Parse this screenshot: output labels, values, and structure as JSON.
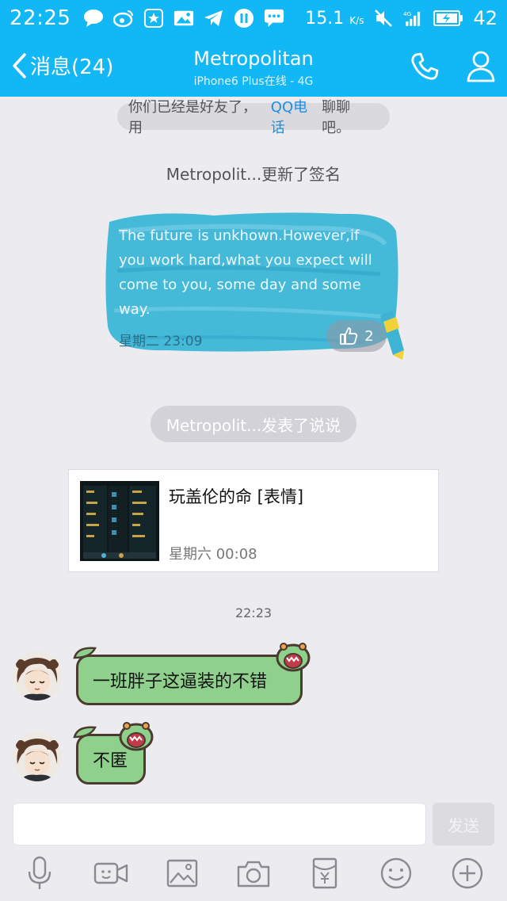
{
  "status_bar": {
    "time": "22:25",
    "net_speed": "15.1",
    "net_unit": "K/s",
    "signal": "4G",
    "battery": "42"
  },
  "nav": {
    "back_label": "消息(24)",
    "title": "Metropolitan",
    "subtitle": "iPhone6 Plus在线 - 4G"
  },
  "system_notice": {
    "prefix": "你们已经是好友了，用",
    "link": "QQ电话",
    "suffix": "聊聊吧。"
  },
  "signature_update": {
    "header": "Metropolit...更新了签名",
    "text": "The future is unkhown.However,if you work hard,what you expect will come to you, some day and some way.",
    "date": "星期二 23:09",
    "likes": "2"
  },
  "post_notice": "Metropolit...发表了说说",
  "post": {
    "title": "玩盖伦的命 [表情]",
    "date": "星期六 00:08"
  },
  "timestamp": "22:23",
  "messages": [
    {
      "text": "一班胖子这逼装的不错"
    },
    {
      "text": "不匿"
    }
  ],
  "input": {
    "placeholder": "",
    "send_label": "发送"
  },
  "toolbar_icons": [
    "microphone-icon",
    "video-icon",
    "image-icon",
    "camera-icon",
    "red-packet-icon",
    "emoji-icon",
    "plus-icon"
  ],
  "colors": {
    "header": "#12b7f5",
    "bubble": "#8fd18c",
    "link": "#1a8fe0"
  }
}
